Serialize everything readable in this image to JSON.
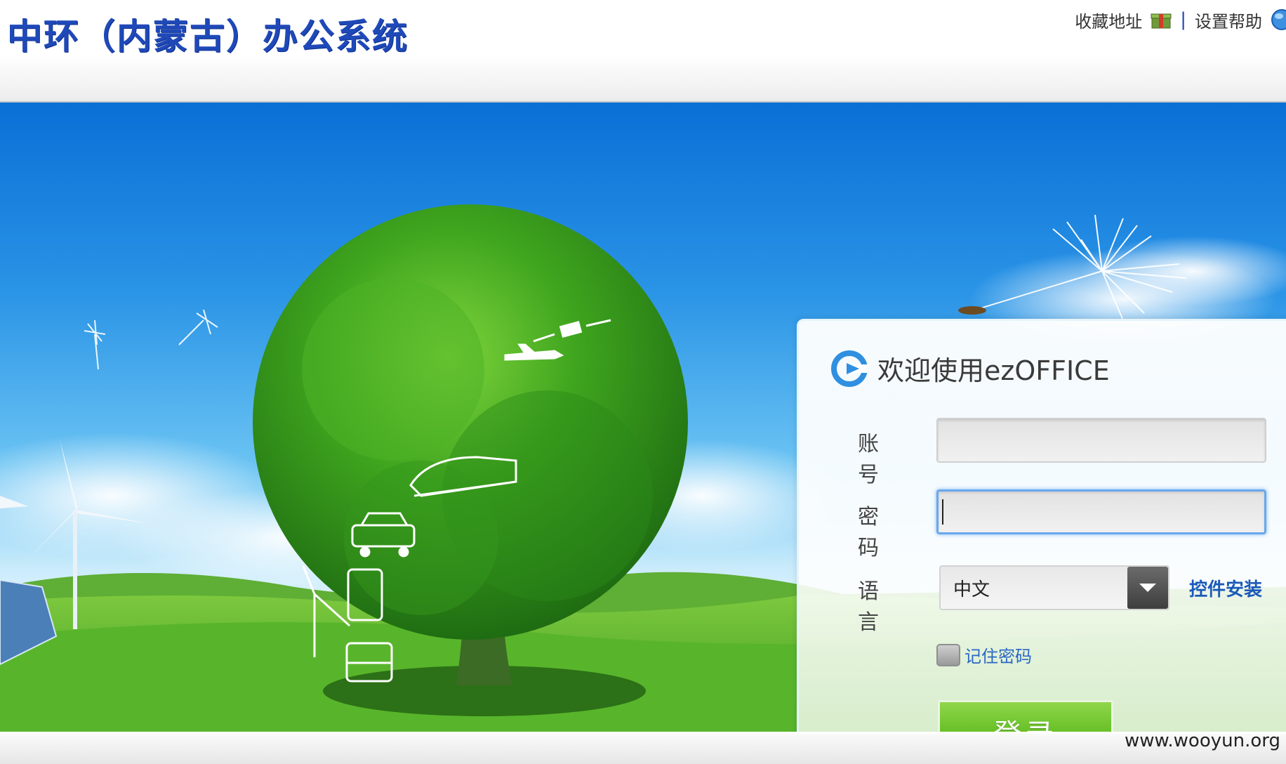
{
  "header": {
    "title": "中环（内蒙古）办公系统",
    "links": {
      "favorite": "收藏地址",
      "separator": "|",
      "help": "设置帮助"
    }
  },
  "login": {
    "title": "欢迎使用ezOFFICE",
    "account_label": "账号",
    "account_value": "",
    "password_label": "密码",
    "password_value": "",
    "language_label": "语言",
    "language_value": "中文",
    "plugin_install": "控件安装",
    "remember_password": "记住密码",
    "remember_checked": false,
    "submit": "登录"
  },
  "footer": {
    "watermark": "www.wooyun.org"
  },
  "colors": {
    "brand": "#1f49b8",
    "login_button": "#6cc22a",
    "link": "#2a66c4",
    "sky": "#2a94e6",
    "grass": "#4caf2a"
  },
  "icons": {
    "favorite": "gift-box-icon",
    "help": "globe-icon",
    "title": "e-logo-icon",
    "dropdown": "chevron-down-icon"
  }
}
